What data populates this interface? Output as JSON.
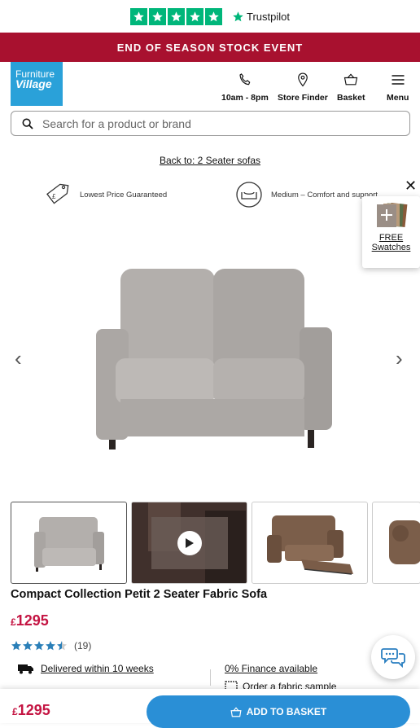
{
  "trustpilot": {
    "brand": "Trustpilot",
    "stars": 5
  },
  "banner": {
    "text": "END OF SEASON STOCK EVENT"
  },
  "logo": {
    "line1": "Furniture",
    "line2": "Village"
  },
  "nav": {
    "phone_label": "10am - 8pm",
    "store_label": "Store Finder",
    "basket_label": "Basket",
    "menu_label": "Menu"
  },
  "search": {
    "placeholder": "Search for a product or brand"
  },
  "breadcrumb": {
    "back": "Back to: 2 Seater sofas"
  },
  "usps": {
    "price": "Lowest Price Guaranteed",
    "comfort": "Medium – Comfort and support"
  },
  "swatches": {
    "line1": "FREE",
    "line2": "Swatches"
  },
  "product": {
    "title": "Compact Collection Petit 2 Seater Fabric Sofa",
    "currency": "£",
    "price": "1295",
    "rating_value": 4.5,
    "review_count": "(19)"
  },
  "info": {
    "delivery": "Delivered within 10 weeks",
    "finance": "0% Finance available",
    "sample": "Order a fabric sample"
  },
  "footer": {
    "currency": "£",
    "price": "1295",
    "cta": "ADD TO BASKET"
  },
  "colors": {
    "brand_red": "#a8112f",
    "price_red": "#c41442",
    "logo_blue": "#2aa1d9",
    "cta_blue": "#2a8fd6",
    "trust_green": "#00b67a"
  }
}
